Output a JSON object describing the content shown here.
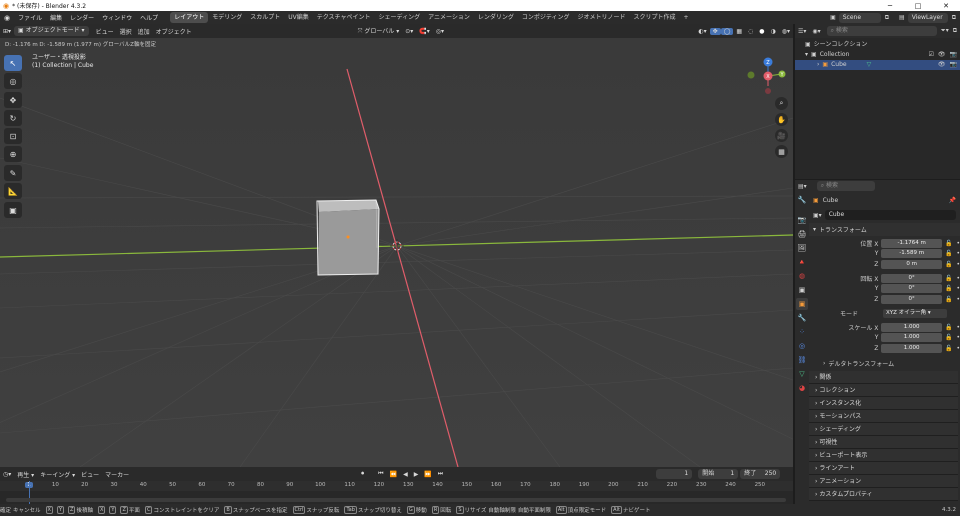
{
  "window": {
    "title": "* (未保存) - Blender 4.3.2",
    "minimize": "─",
    "maximize": "□",
    "close": "✕"
  },
  "menubar": {
    "items": [
      "ファイル",
      "編集",
      "レンダー",
      "ウィンドウ",
      "ヘルプ"
    ]
  },
  "workspaces": [
    "レイアウト",
    "モデリング",
    "スカルプト",
    "UV編集",
    "テクスチャペイント",
    "シェーディング",
    "アニメーション",
    "レンダリング",
    "コンポジティング",
    "ジオメトリノード",
    "スクリプト作成"
  ],
  "workspace_add": "+",
  "scene": {
    "name": "Scene",
    "view_layer": "ViewLayer"
  },
  "viewport_header": {
    "mode": "オブジェクトモード",
    "menus": [
      "ビュー",
      "選択",
      "追加",
      "オブジェクト"
    ],
    "orientation": "グローバル"
  },
  "viewport": {
    "status": "D: -1.176 m  D: -1.589 m (1.977 m) グローバルZ軸を固定",
    "view_name": "ユーザー・透視投影",
    "collection_info": "(1) Collection | Cube"
  },
  "gizmo": {
    "x": "X",
    "y": "Y",
    "z": "Z"
  },
  "outliner": {
    "search_placeholder": "検索",
    "root": "シーンコレクション",
    "collection": "Collection",
    "object": "Cube"
  },
  "properties": {
    "search_placeholder": "検索",
    "object_name": "Cube",
    "data_name": "Cube",
    "transform_header": "トランスフォーム",
    "location": {
      "label": "位置 X",
      "x": "-1.1764 m",
      "y": "-1.589 m",
      "z": "0 m"
    },
    "rotation": {
      "label": "回転 X",
      "x": "0°",
      "y": "0°",
      "z": "0°"
    },
    "mode": {
      "label": "モード",
      "value": "XYZ オイラー角"
    },
    "scale": {
      "label": "スケール X",
      "x": "1.000",
      "y": "1.000",
      "z": "1.000"
    },
    "axis_y": "Y",
    "axis_z": "Z",
    "delta": "デルタトランスフォーム",
    "panels": [
      "関係",
      "コレクション",
      "インスタンス化",
      "モーションパス",
      "シェーディング",
      "可視性",
      "ビューポート表示",
      "ラインアート",
      "アニメーション",
      "カスタムプロパティ"
    ]
  },
  "timeline": {
    "menus": [
      "再生",
      "キーイング",
      "ビュー",
      "マーカー"
    ],
    "current_frame": "1",
    "start_label": "開始",
    "start": "1",
    "end_label": "終了",
    "end": "250",
    "ticks": [
      "1",
      "10",
      "20",
      "30",
      "40",
      "50",
      "60",
      "70",
      "80",
      "90",
      "100",
      "110",
      "120",
      "130",
      "140",
      "150",
      "160",
      "170",
      "180",
      "190",
      "200",
      "210",
      "220",
      "230",
      "240",
      "250"
    ]
  },
  "statusbar": {
    "items": [
      "確定",
      "キャンセル",
      "X",
      "Y",
      "Z",
      "後積軸",
      "X",
      "Y",
      "Z",
      "平面",
      "C",
      "コンストレイントをクリア",
      "B",
      "スナップベースを指定",
      "Ctrl",
      "スナップ反転",
      "Tab",
      "スナップ切り替え",
      "G",
      "移動",
      "R",
      "回転",
      "S",
      "リサイズ",
      "自動軸制限",
      "自動平面制限",
      "Alt",
      "頂点限定モード",
      "Alt",
      "ナビゲート"
    ],
    "version": "4.3.2"
  },
  "colors": {
    "x_axis": "#e05d6a",
    "y_axis": "#8ab83c",
    "z_axis": "#3a7cdb",
    "selection": "#4772b3",
    "viewport_bg": "#3d3d3d"
  }
}
